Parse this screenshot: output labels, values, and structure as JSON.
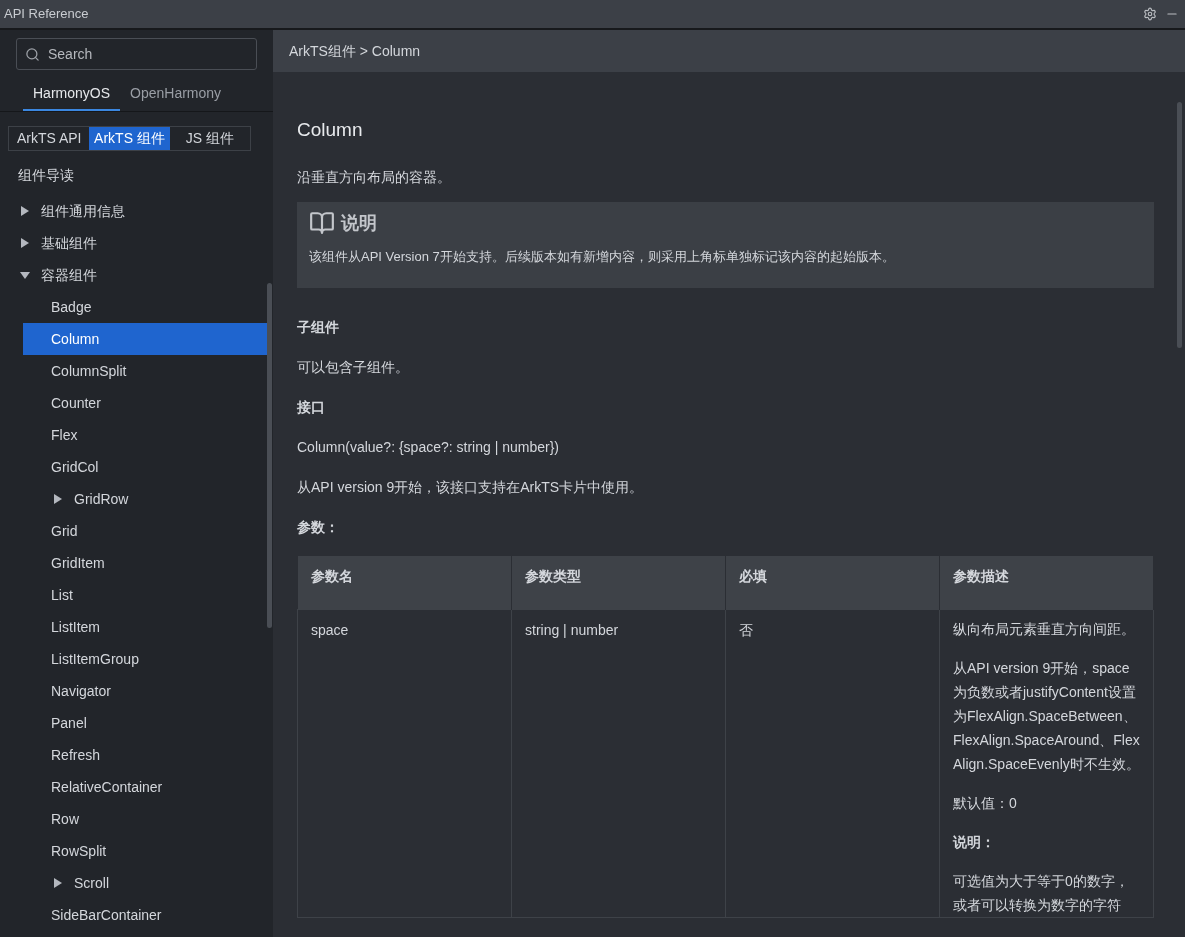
{
  "window": {
    "title": "API Reference"
  },
  "search": {
    "placeholder": "Search"
  },
  "tabs": [
    {
      "label": "HarmonyOS",
      "selected": true
    },
    {
      "label": "OpenHarmony",
      "selected": false
    }
  ],
  "segments": [
    {
      "label": "ArkTS API",
      "selected": false
    },
    {
      "label": "ArkTS 组件",
      "selected": true
    },
    {
      "label": "JS 组件",
      "selected": false
    }
  ],
  "guide": "组件导读",
  "tree": [
    {
      "label": "组件通用信息",
      "expanded": false,
      "selected": false
    },
    {
      "label": "基础组件",
      "expanded": false,
      "selected": false
    },
    {
      "label": "容器组件",
      "expanded": true,
      "selected": false,
      "children": [
        {
          "label": "Badge",
          "selected": false
        },
        {
          "label": "Column",
          "selected": true
        },
        {
          "label": "ColumnSplit",
          "selected": false
        },
        {
          "label": "Counter",
          "selected": false
        },
        {
          "label": "Flex",
          "selected": false
        },
        {
          "label": "GridCol",
          "selected": false
        },
        {
          "label": "GridRow",
          "expanded": false,
          "selected": false
        },
        {
          "label": "Grid",
          "selected": false
        },
        {
          "label": "GridItem",
          "selected": false
        },
        {
          "label": "List",
          "selected": false
        },
        {
          "label": "ListItem",
          "selected": false
        },
        {
          "label": "ListItemGroup",
          "selected": false
        },
        {
          "label": "Navigator",
          "selected": false
        },
        {
          "label": "Panel",
          "selected": false
        },
        {
          "label": "Refresh",
          "selected": false
        },
        {
          "label": "RelativeContainer",
          "selected": false
        },
        {
          "label": "Row",
          "selected": false
        },
        {
          "label": "RowSplit",
          "selected": false
        },
        {
          "label": "Scroll",
          "expanded": false,
          "selected": false
        },
        {
          "label": "SideBarContainer",
          "selected": false
        }
      ]
    }
  ],
  "breadcrumb": "ArkTS组件 > Column",
  "page": {
    "title": "Column",
    "intro": "沿垂直方向布局的容器。",
    "note": {
      "title": "说明",
      "text": "该组件从API Version 7开始支持。后续版本如有新增内容，则采用上角标单独标记该内容的起始版本。"
    },
    "sections": [
      {
        "kind": "heading",
        "text": "子组件"
      },
      {
        "kind": "text",
        "text": "可以包含子组件。"
      },
      {
        "kind": "heading",
        "text": "接口"
      },
      {
        "kind": "text",
        "text": "Column(value?: {space?: string | number})"
      },
      {
        "kind": "text",
        "text": "从API version 9开始，该接口支持在ArkTS卡片中使用。"
      },
      {
        "kind": "heading",
        "text": "参数："
      }
    ],
    "table": {
      "columns": [
        "参数名",
        "参数类型",
        "必填",
        "参数描述"
      ],
      "rows": [
        {
          "name": "space",
          "type": "string | number",
          "required": "否",
          "description": [
            {
              "text": "纵向布局元素垂直方向间距。",
              "bold": false
            },
            {
              "text": "从API version 9开始，space为负数或者justifyContent设置为FlexAlign.SpaceBetween、FlexAlign.SpaceAround、FlexAlign.SpaceEvenly时不生效。",
              "bold": false
            },
            {
              "text": "默认值：0",
              "bold": false
            },
            {
              "text": "说明：",
              "bold": true
            },
            {
              "text": "可选值为大于等于0的数字，或者可以转换为数字的字符",
              "bold": false
            }
          ]
        }
      ]
    }
  }
}
